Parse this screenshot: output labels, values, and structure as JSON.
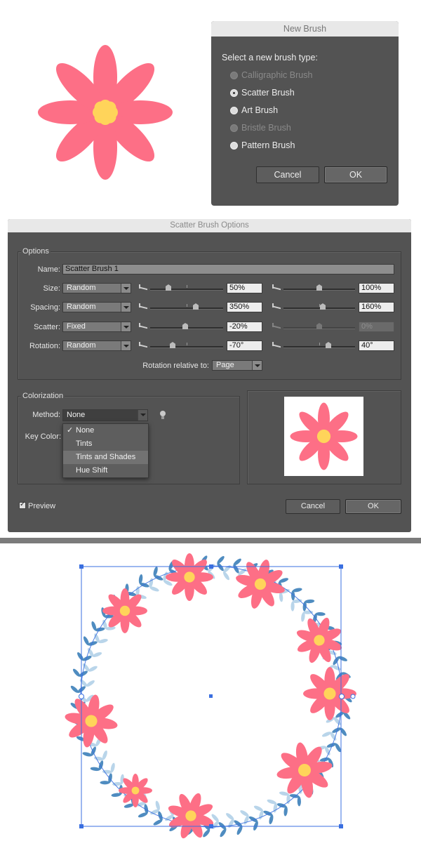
{
  "new_brush": {
    "title": "New Brush",
    "prompt": "Select a new brush type:",
    "options": [
      {
        "label": "Calligraphic Brush",
        "state": "disabled"
      },
      {
        "label": "Scatter Brush",
        "state": "selected"
      },
      {
        "label": "Art Brush",
        "state": "normal"
      },
      {
        "label": "Bristle Brush",
        "state": "disabled"
      },
      {
        "label": "Pattern Brush",
        "state": "normal"
      }
    ],
    "cancel_label": "Cancel",
    "ok_label": "OK"
  },
  "scatter_options": {
    "title": "Scatter Brush Options",
    "options_group": "Options",
    "name_label": "Name:",
    "name_value": "Scatter Brush 1",
    "rows": [
      {
        "label": "Size:",
        "mode": "Random",
        "min": "50%",
        "max": "100%",
        "min_pos": 0.25,
        "max_pos": 0.5
      },
      {
        "label": "Spacing:",
        "mode": "Random",
        "min": "350%",
        "max": "160%",
        "min_pos": 0.62,
        "max_pos": 0.55
      },
      {
        "label": "Scatter:",
        "mode": "Fixed",
        "min": "-20%",
        "max": "0%",
        "min_pos": 0.45,
        "max_pos": 0.5
      },
      {
        "label": "Rotation:",
        "mode": "Random",
        "min": "-70°",
        "max": "40°",
        "min_pos": 0.3,
        "max_pos": 0.62
      }
    ],
    "rotation_relative_label": "Rotation relative to:",
    "rotation_relative_value": "Page",
    "colorization_group": "Colorization",
    "method_label": "Method:",
    "method_value": "None",
    "key_color_label": "Key Color:",
    "method_menu": [
      {
        "label": "None",
        "checked": true
      },
      {
        "label": "Tints",
        "checked": false
      },
      {
        "label": "Tints and Shades",
        "checked": false,
        "highlighted": true
      },
      {
        "label": "Hue Shift",
        "checked": false
      }
    ],
    "preview_label": "Preview",
    "cancel_label": "Cancel",
    "ok_label": "OK"
  },
  "colors": {
    "petal": "#fd6f86",
    "center": "#ffd45a",
    "leaf_dark": "#4f8cc0",
    "leaf_light": "#b9d5ea",
    "selection": "#3a6fe0"
  }
}
